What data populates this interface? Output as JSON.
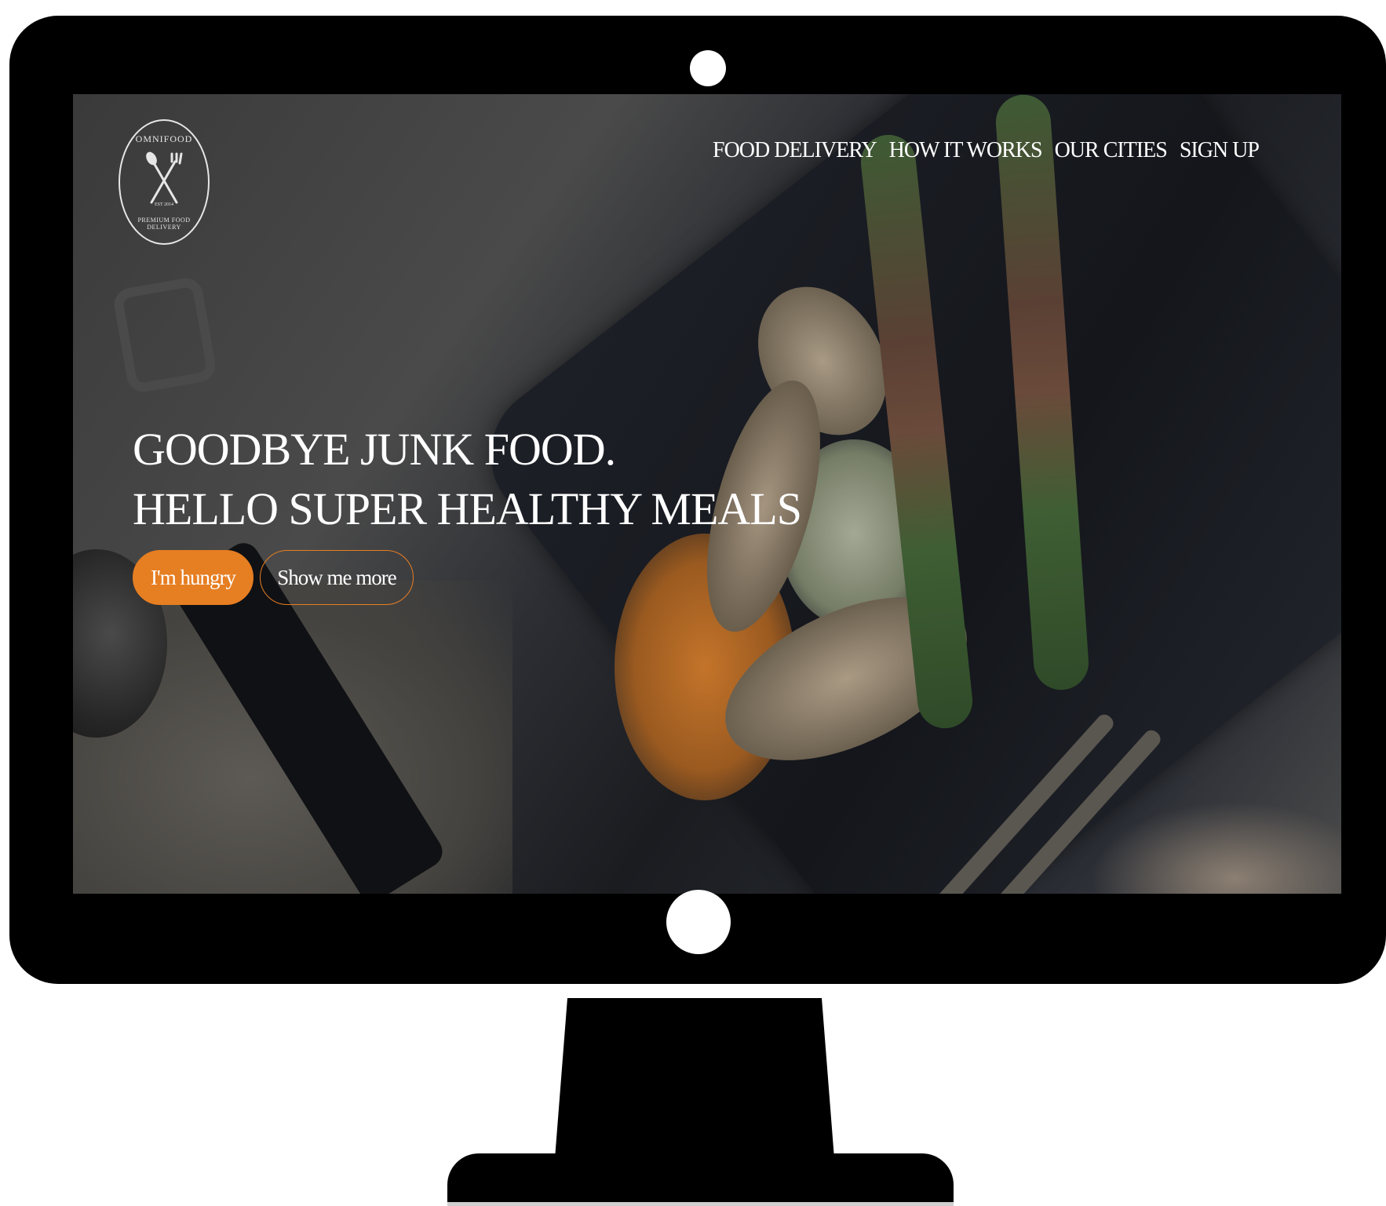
{
  "logo": {
    "brand": "OMNIFOOD",
    "tagline": "PREMIUM FOOD DELIVERY",
    "est": "EST 2014"
  },
  "nav": {
    "items": [
      {
        "label": "FOOD DELIVERY"
      },
      {
        "label": "HOW IT WORKS"
      },
      {
        "label": "OUR CITIES"
      },
      {
        "label": "SIGN UP"
      }
    ]
  },
  "hero": {
    "title_line1": "GOODBYE JUNK FOOD.",
    "title_line2": "HELLO SUPER HEALTHY MEALS",
    "primary_button": "I'm hungry",
    "secondary_button": "Show me more"
  },
  "colors": {
    "accent": "#e67e22",
    "text": "#ffffff",
    "bezel": "#000000"
  },
  "icons": {
    "logo_cutlery": "spoon-fork-icon"
  }
}
